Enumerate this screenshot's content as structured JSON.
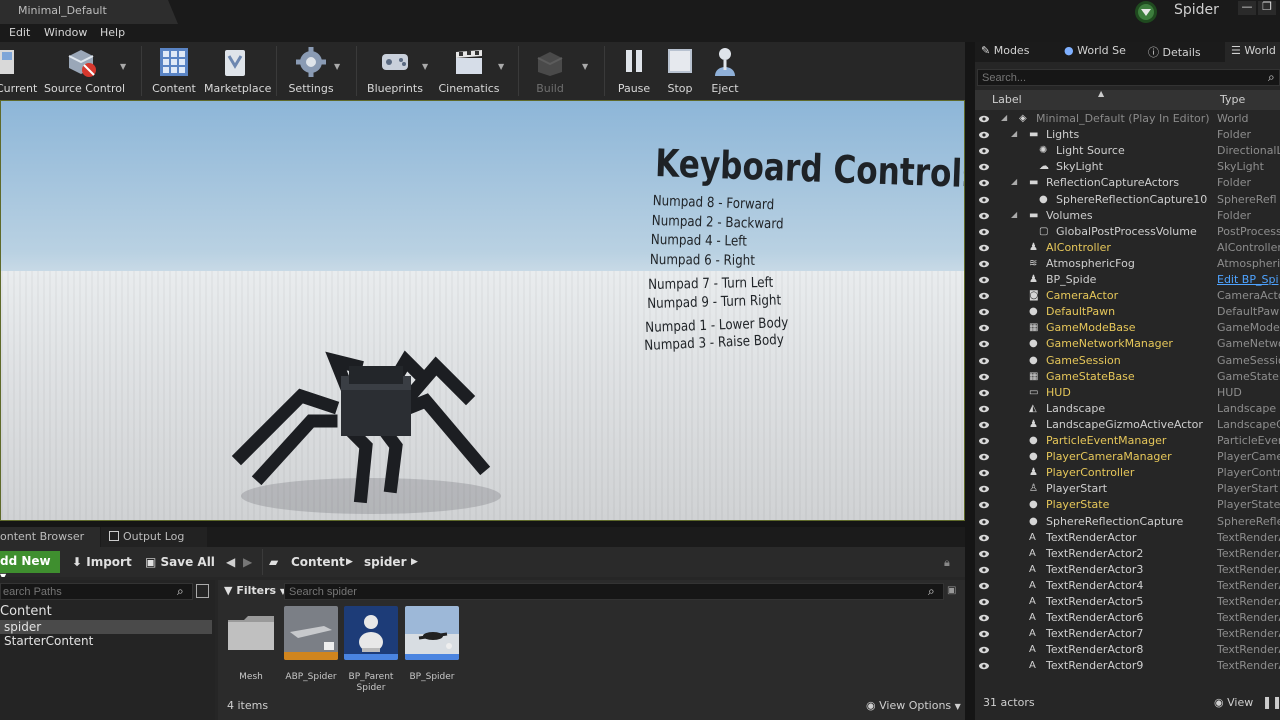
{
  "window": {
    "tab_title": "Minimal_Default",
    "project_name": "Spider",
    "controls": [
      "—",
      "❐"
    ]
  },
  "menu": [
    "Edit",
    "Window",
    "Help"
  ],
  "toolbar": {
    "buttons": [
      {
        "label": "Current",
        "icon": "save-current-icon",
        "enabled": true
      },
      {
        "label": "Source Control",
        "icon": "source-control-icon",
        "enabled": true
      },
      {
        "label": "Content",
        "icon": "content-icon",
        "enabled": true
      },
      {
        "label": "Marketplace",
        "icon": "marketplace-icon",
        "enabled": true
      },
      {
        "label": "Settings",
        "icon": "settings-icon",
        "enabled": true
      },
      {
        "label": "Blueprints",
        "icon": "blueprints-icon",
        "enabled": true
      },
      {
        "label": "Cinematics",
        "icon": "cinematics-icon",
        "enabled": true
      },
      {
        "label": "Build",
        "icon": "build-icon",
        "enabled": false
      },
      {
        "label": "Pause",
        "icon": "pause-icon",
        "enabled": true
      },
      {
        "label": "Stop",
        "icon": "stop-icon",
        "enabled": true
      },
      {
        "label": "Eject",
        "icon": "eject-icon",
        "enabled": true
      }
    ]
  },
  "viewport": {
    "keyboard_title": "Keyboard Controls",
    "controls": [
      "Numpad 8 - Forward",
      "Numpad 2 - Backward",
      "Numpad 4 - Left",
      "Numpad 6 - Right",
      "Numpad 7 - Turn Left",
      "Numpad 9 - Turn Right",
      "Numpad 1 - Lower Body",
      "Numpad 3 -  Raise Body"
    ]
  },
  "content_browser": {
    "tabs": [
      "ontent Browser",
      "Output Log"
    ],
    "add_new": "dd New",
    "import": "Import",
    "save_all": "Save All",
    "breadcrumbs": [
      "Content",
      "spider"
    ],
    "search_paths_placeholder": "earch Paths",
    "tree": [
      "Content",
      "spider",
      "StarterContent"
    ],
    "filters_label": "Filters",
    "search_placeholder": "Search spider",
    "assets": [
      {
        "label": "Mesh"
      },
      {
        "label": "ABP_Spider"
      },
      {
        "label": "BP_Parent Spider"
      },
      {
        "label": "BP_Spider"
      }
    ],
    "item_count": "4 items",
    "view_options": "View Options"
  },
  "right_panel": {
    "tabs": [
      "Modes",
      "World Se",
      "Details",
      "World"
    ],
    "search_placeholder": "Search...",
    "col_label": "Label",
    "col_type": "Type",
    "rows": [
      {
        "label": "Minimal_Default (Play In Editor)",
        "type": "World",
        "color": "#8a8a8a",
        "indent": 0,
        "icon": "world-icon"
      },
      {
        "label": "Lights",
        "type": "Folder",
        "color": "#cfcfcf",
        "indent": 1,
        "icon": "folder-icon"
      },
      {
        "label": "Light Source",
        "type": "DirectionalLi",
        "color": "#cfcfcf",
        "indent": 2,
        "icon": "light-icon"
      },
      {
        "label": "SkyLight",
        "type": "SkyLight",
        "color": "#cfcfcf",
        "indent": 2,
        "icon": "skylight-icon"
      },
      {
        "label": "ReflectionCaptureActors",
        "type": "Folder",
        "color": "#cfcfcf",
        "indent": 1,
        "icon": "folder-icon"
      },
      {
        "label": "SphereReflectionCapture10",
        "type": "SphereRefl",
        "color": "#cfcfcf",
        "indent": 2,
        "icon": "sphere-icon"
      },
      {
        "label": "Volumes",
        "type": "Folder",
        "color": "#cfcfcf",
        "indent": 1,
        "icon": "folder-icon"
      },
      {
        "label": "GlobalPostProcessVolume",
        "type": "PostProcess",
        "color": "#cfcfcf",
        "indent": 2,
        "icon": "volume-icon"
      },
      {
        "label": "AIController",
        "type": "AIController",
        "color": "#e6c75a",
        "indent": 1,
        "icon": "actor-icon"
      },
      {
        "label": "AtmosphericFog",
        "type": "Atmospheric",
        "color": "#cfcfcf",
        "indent": 1,
        "icon": "fog-icon"
      },
      {
        "label": "BP_Spide",
        "type": "Edit BP_Spi",
        "color": "#cfcfcf",
        "indent": 1,
        "icon": "actor-icon",
        "type_link": true
      },
      {
        "label": "CameraActor",
        "type": "CameraActor",
        "color": "#e6c75a",
        "indent": 1,
        "icon": "camera-icon"
      },
      {
        "label": "DefaultPawn",
        "type": "DefaultPawn",
        "color": "#e6c75a",
        "indent": 1,
        "icon": "pawn-icon"
      },
      {
        "label": "GameModeBase",
        "type": "GameModeBa",
        "color": "#e6c75a",
        "indent": 1,
        "icon": "gamemode-icon"
      },
      {
        "label": "GameNetworkManager",
        "type": "GameNetwork",
        "color": "#e6c75a",
        "indent": 1,
        "icon": "sphere-icon"
      },
      {
        "label": "GameSession",
        "type": "GameSession",
        "color": "#e6c75a",
        "indent": 1,
        "icon": "sphere-icon"
      },
      {
        "label": "GameStateBase",
        "type": "GameStateBa",
        "color": "#e6c75a",
        "indent": 1,
        "icon": "gamemode-icon"
      },
      {
        "label": "HUD",
        "type": "HUD",
        "color": "#e6c75a",
        "indent": 1,
        "icon": "hud-icon"
      },
      {
        "label": "Landscape",
        "type": "Landscape",
        "color": "#cfcfcf",
        "indent": 1,
        "icon": "landscape-icon"
      },
      {
        "label": "LandscapeGizmoActiveActor",
        "type": "LandscapeGi",
        "color": "#cfcfcf",
        "indent": 1,
        "icon": "actor-icon"
      },
      {
        "label": "ParticleEventManager",
        "type": "ParticleEvent",
        "color": "#e6c75a",
        "indent": 1,
        "icon": "sphere-icon"
      },
      {
        "label": "PlayerCameraManager",
        "type": "PlayerCamer",
        "color": "#e6c75a",
        "indent": 1,
        "icon": "sphere-icon"
      },
      {
        "label": "PlayerController",
        "type": "PlayerContro",
        "color": "#e6c75a",
        "indent": 1,
        "icon": "actor-icon"
      },
      {
        "label": "PlayerStart",
        "type": "PlayerStart",
        "color": "#cfcfcf",
        "indent": 1,
        "icon": "playerstart-icon"
      },
      {
        "label": "PlayerState",
        "type": "PlayerState",
        "color": "#e6c75a",
        "indent": 1,
        "icon": "sphere-icon"
      },
      {
        "label": "SphereReflectionCapture",
        "type": "SphereRefle",
        "color": "#cfcfcf",
        "indent": 1,
        "icon": "sphere-icon"
      },
      {
        "label": "TextRenderActor",
        "type": "TextRenderA",
        "color": "#cfcfcf",
        "indent": 1,
        "icon": "text-icon"
      },
      {
        "label": "TextRenderActor2",
        "type": "TextRenderA",
        "color": "#cfcfcf",
        "indent": 1,
        "icon": "text-icon"
      },
      {
        "label": "TextRenderActor3",
        "type": "TextRenderA",
        "color": "#cfcfcf",
        "indent": 1,
        "icon": "text-icon"
      },
      {
        "label": "TextRenderActor4",
        "type": "TextRenderA",
        "color": "#cfcfcf",
        "indent": 1,
        "icon": "text-icon"
      },
      {
        "label": "TextRenderActor5",
        "type": "TextRenderA",
        "color": "#cfcfcf",
        "indent": 1,
        "icon": "text-icon"
      },
      {
        "label": "TextRenderActor6",
        "type": "TextRenderA",
        "color": "#cfcfcf",
        "indent": 1,
        "icon": "text-icon"
      },
      {
        "label": "TextRenderActor7",
        "type": "TextRenderA",
        "color": "#cfcfcf",
        "indent": 1,
        "icon": "text-icon"
      },
      {
        "label": "TextRenderActor8",
        "type": "TextRenderA",
        "color": "#cfcfcf",
        "indent": 1,
        "icon": "text-icon"
      },
      {
        "label": "TextRenderActor9",
        "type": "TextRenderA",
        "color": "#cfcfcf",
        "indent": 1,
        "icon": "text-icon"
      }
    ],
    "actors_count": "31 actors",
    "view_label": "View"
  },
  "colors": {
    "accent_green": "#3f8f2f",
    "viewport_border": "#5f6a2a",
    "highlight_yellow": "#e6c75a",
    "link_blue": "#4ea3ff"
  }
}
